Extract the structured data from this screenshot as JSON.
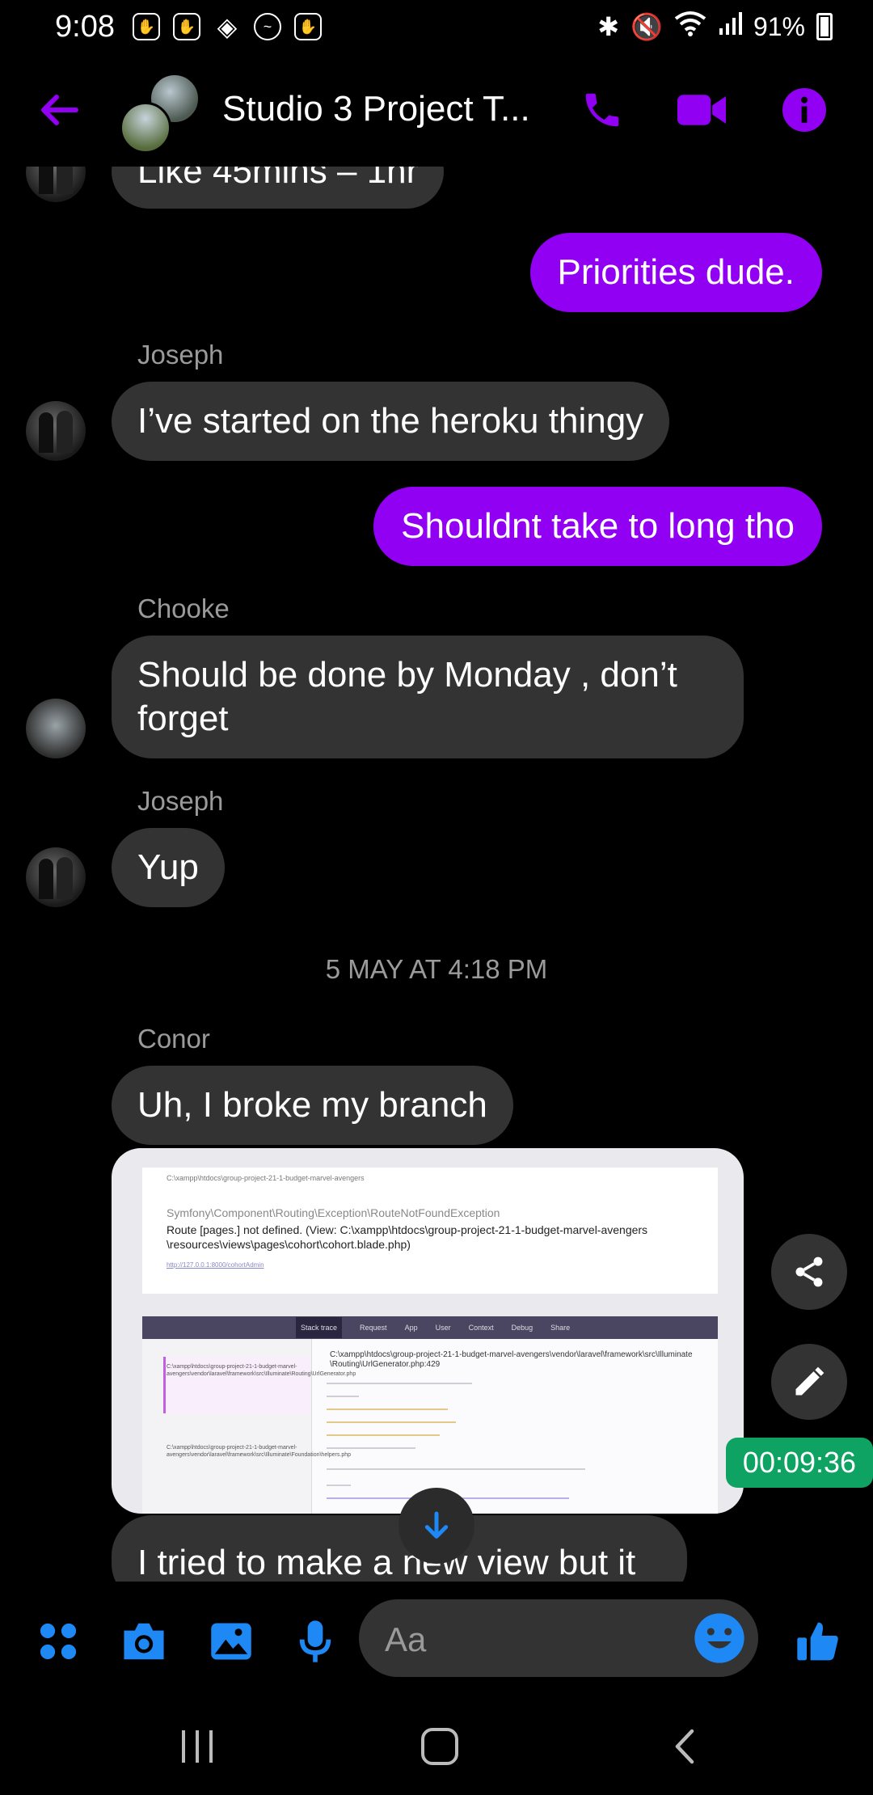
{
  "status_bar": {
    "time": "9:08",
    "battery": "91%",
    "left_icons": [
      "hamsa-icon",
      "hamsa-icon",
      "binance-icon",
      "messenger-icon",
      "hamsa-icon"
    ],
    "right_icons": [
      "bluetooth-icon",
      "mute-icon",
      "wifi-icon",
      "signal-icon",
      "battery-icon"
    ]
  },
  "header": {
    "title": "Studio 3 Project T...",
    "actions": [
      "phone-icon",
      "video-icon",
      "info-icon"
    ],
    "accent": "#9100f2"
  },
  "messages": [
    {
      "type": "incoming",
      "text": "Like 45mins – 1hr",
      "partial": true
    },
    {
      "type": "outgoing",
      "text": "Priorities dude."
    },
    {
      "type": "sender",
      "text": "Joseph"
    },
    {
      "type": "incoming",
      "text": "I’ve started on the heroku thingy"
    },
    {
      "type": "outgoing",
      "text": "Shouldnt take to long tho"
    },
    {
      "type": "sender",
      "text": "Chooke"
    },
    {
      "type": "incoming",
      "text": "Should be done by Monday , don’t forget"
    },
    {
      "type": "sender",
      "text": "Joseph"
    },
    {
      "type": "incoming",
      "text": "Yup"
    },
    {
      "type": "timestamp",
      "text": "5 MAY AT 4:18 PM"
    },
    {
      "type": "sender",
      "text": "Conor"
    },
    {
      "type": "incoming",
      "text": "Uh, I broke my branch"
    },
    {
      "type": "incoming",
      "text": "I tried to make a new view but it",
      "partial": true
    }
  ],
  "shot": {
    "path": "C:\\xampp\\htdocs\\group-project-21-1-budget-marvel-avengers",
    "exception": "Symfony\\Component\\Routing\\Exception\\RouteNotFoundException",
    "message": "Route [pages.] not defined. (View: C:\\xampp\\htdocs\\group-project-21-1-budget-marvel-avengers \\resources\\views\\pages\\cohort\\cohort.blade.php)",
    "tabs": [
      "Stack trace",
      "Request",
      "App",
      "User",
      "Context",
      "Debug",
      "Share"
    ],
    "file_title": "C:\\xampp\\htdocs\\group-project-21-1-budget-marvel-avengers\\vendor\\laravel\\framework\\src\\Illuminate \\Routing\\UrlGenerator.php:429",
    "side_items": [
      "C:\\xampp\\htdocs\\group-project-21-1-budget-marvel-avengers\\vendor\\laravel\\framework\\src\\Illuminate\\Routing\\UrlGenerator.php",
      "C:\\xampp\\htdocs\\group-project-21-1-budget-marvel-avengers\\vendor\\laravel\\framework\\src\\Illuminate\\Foundation\\helpers.php"
    ]
  },
  "timer": "00:09:36",
  "composer": {
    "placeholder": "Aa",
    "icons": [
      "apps-icon",
      "camera-icon",
      "gallery-icon",
      "mic-icon",
      "emoji-icon",
      "thumbs-up-icon"
    ]
  },
  "nav": [
    "recents-icon",
    "home-icon",
    "back-icon"
  ]
}
